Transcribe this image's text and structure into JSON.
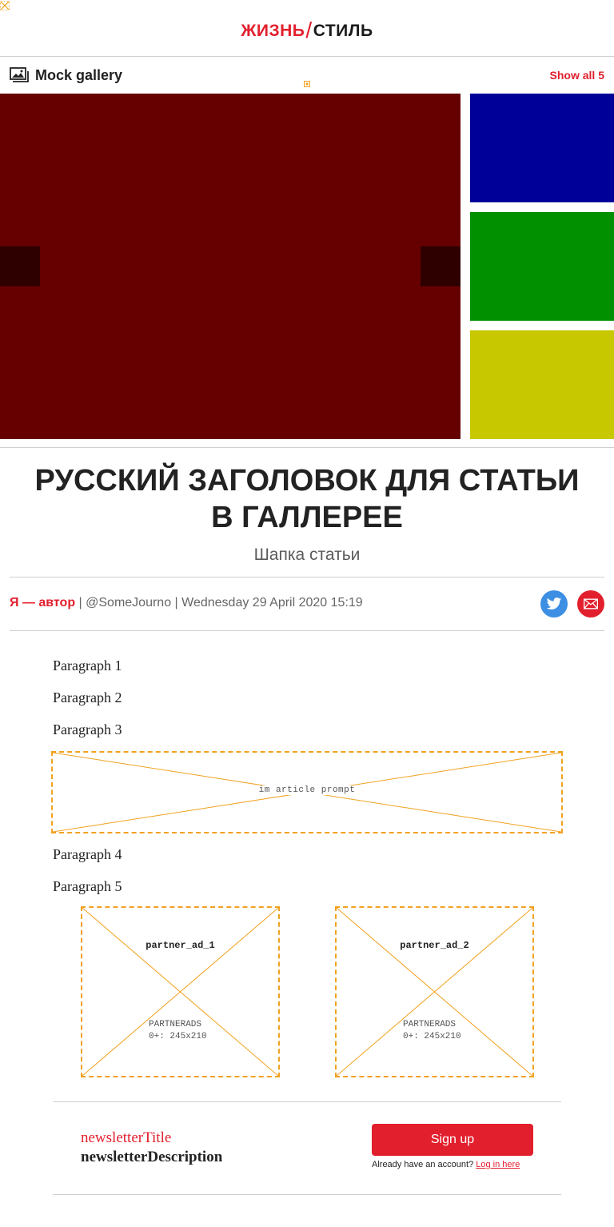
{
  "header": {
    "brand_left": "ЖИЗНЬ",
    "brand_slash": "/",
    "brand_right": "СТИЛЬ"
  },
  "gallery": {
    "title": "Mock gallery",
    "show_all": "Show all 5",
    "slides": {
      "main_color": "#660000",
      "thumbs": [
        "#000099",
        "#009000",
        "#c8c800"
      ]
    }
  },
  "article": {
    "headline": "РУССКИЙ ЗАГОЛОВОК ДЛЯ СТАТЬИ В ГАЛЛЕРЕЕ",
    "standfirst": "Шапка статьи",
    "author": "Я — автор",
    "meta_rest": " | @SomeJourno | Wednesday 29 April 2020 15:19",
    "paragraphs": [
      "Paragraph 1",
      "Paragraph 2",
      "Paragraph 3",
      "Paragraph 4",
      "Paragraph 5"
    ],
    "prompt_label": "im article prompt",
    "ads": [
      {
        "name": "partner_ad_1",
        "line1": "PARTNERADS",
        "line2": "0+: 245x210"
      },
      {
        "name": "partner_ad_2",
        "line1": "PARTNERADS",
        "line2": "0+: 245x210"
      }
    ]
  },
  "share": {
    "twitter_icon": "twitter-icon",
    "mail_icon": "mail-icon",
    "twitter_color": "#3d8fe3",
    "mail_color": "#e21f2d"
  },
  "newsletter": {
    "title": "newsletterTitle",
    "description": "newsletterDescription",
    "signup_label": "Sign up",
    "login_prompt": "Already have an account? ",
    "login_link": "Log in here"
  },
  "colors": {
    "accent": "#e21f2d",
    "placeholder_border": "#f0a21f"
  }
}
